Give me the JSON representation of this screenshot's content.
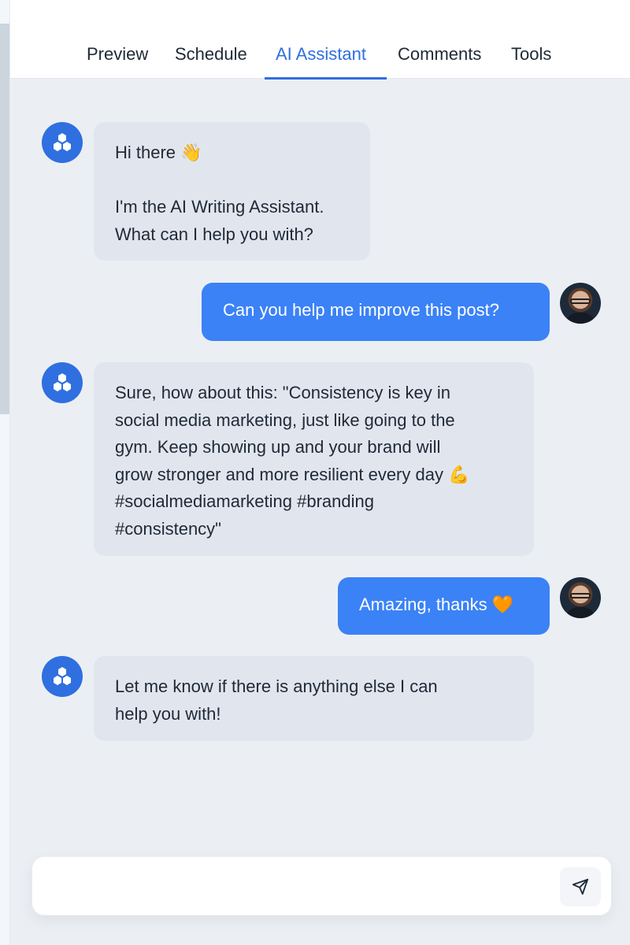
{
  "tabs": [
    {
      "label": "Preview"
    },
    {
      "label": "Schedule"
    },
    {
      "label": "AI Assistant",
      "active": true
    },
    {
      "label": "Comments"
    },
    {
      "label": "Tools"
    }
  ],
  "messages": [
    {
      "sender": "assistant",
      "text": "Hi there 👋\n\nI'm the AI Writing Assistant.\nWhat can I help you with?"
    },
    {
      "sender": "user",
      "text": "Can you help me improve this post?"
    },
    {
      "sender": "assistant",
      "text": "Sure, how about this: \"Consistency is key in\nsocial media marketing, just like going to the\ngym. Keep showing up and your brand will\ngrow stronger and more resilient every day 💪\n#socialmediamarketing #branding\n#consistency\""
    },
    {
      "sender": "user",
      "text": "Amazing, thanks 🧡"
    },
    {
      "sender": "assistant",
      "text": "Let me know if there is anything else I can\nhelp you with!"
    }
  ],
  "composer": {
    "value": "",
    "placeholder": ""
  },
  "icons": {
    "assistant_avatar": "hexagon-cluster-icon",
    "user_avatar": "user-photo-avatar",
    "send": "paper-plane-icon"
  },
  "colors": {
    "accent": "#2f6fe0",
    "user_bubble": "#3b82f6",
    "assistant_bubble": "#e1e6ee",
    "panel_bg": "#ebeff4"
  }
}
